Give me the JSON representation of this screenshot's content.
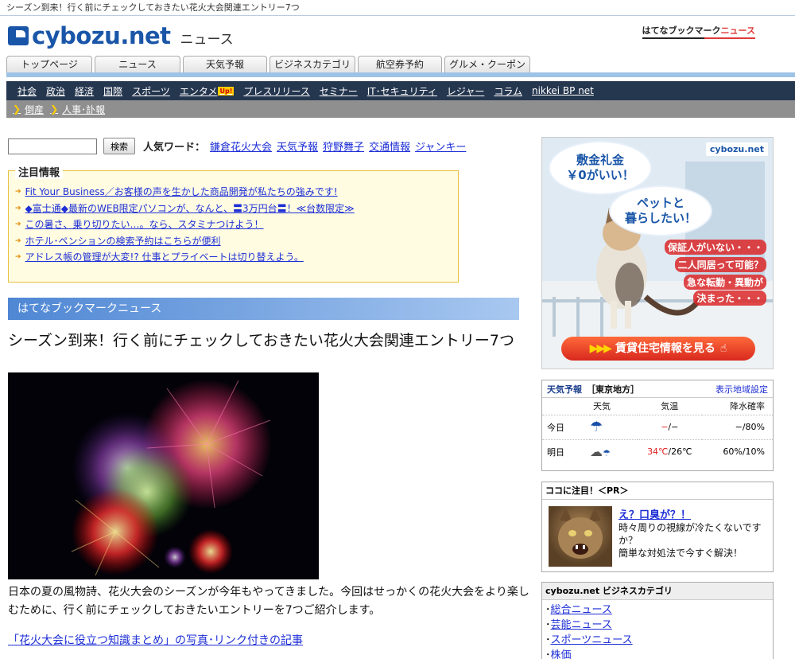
{
  "topline": "シーズン到来！行く前にチェックしておきたい花火大会関連エントリー7つ",
  "header": {
    "logo_main": "cybozu",
    "logo_tld": ".net",
    "logo_sub": "ニュース",
    "badge_dark": "はてなブックマーク",
    "badge_accent": "ニュース"
  },
  "tabs": [
    {
      "label": "トップページ"
    },
    {
      "label": "ニュース"
    },
    {
      "label": "天気予報"
    },
    {
      "label": "ビジネスカテゴリ"
    },
    {
      "label": "航空券予約"
    },
    {
      "label": "グルメ・クーポン"
    }
  ],
  "nav": [
    {
      "label": "社会"
    },
    {
      "label": "政治"
    },
    {
      "label": "経済"
    },
    {
      "label": "国際"
    },
    {
      "label": "スポーツ"
    },
    {
      "label": "エンタメ",
      "badge": "Up!"
    },
    {
      "label": "プレスリリース"
    },
    {
      "label": "セミナー"
    },
    {
      "label": "IT･セキュリティ"
    },
    {
      "label": "レジャー"
    },
    {
      "label": "コラム"
    },
    {
      "label": "nikkei BP net"
    }
  ],
  "subnav": [
    {
      "label": "倒産"
    },
    {
      "label": "人事･訃報"
    }
  ],
  "search": {
    "value": "",
    "button": "検索",
    "popular_label": "人気ワード：",
    "words": [
      "鎌倉花火大会",
      "天気予報",
      "狩野舞子",
      "交通情報",
      "ジャンキー"
    ]
  },
  "notice": {
    "title": "注目情報",
    "items": [
      "Fit Your Business／お客様の声を生かした商品開発が私たちの強みです!",
      "◆富士通◆最新のWEB限定パソコンが、なんと、〓3万円台〓！≪台数限定≫",
      "この暑さ、乗り切りたい…。なら、スタミナつけよう！",
      "ホテル･ペンションの検索予約はこちらが便利",
      "アドレス帳の管理が大変!? 仕事とプライベートは切り替えよう。"
    ]
  },
  "hatena_bar": "はてなブックマークニュース",
  "article": {
    "title": "シーズン到来！行く前にチェックしておきたい花火大会関連エントリー7つ",
    "body": "日本の夏の風物詩、花火大会のシーズンが今年もやってきました。今回はせっかくの花火大会をより楽しむために、行く前にチェックしておきたいエントリーを7つご紹介します。",
    "link": "「花火大会に役立つ知識まとめ」の写真･リンク付きの記事"
  },
  "ad": {
    "logo": "cybozu.net",
    "bubble1": "敷金礼金\n￥0がいい！",
    "bubble2": "ペットと\n暮らしたい！",
    "red_lines": [
      "保証人がいない・・・",
      "二人同居って可能？",
      "急な転勤・異動が",
      "決まった・・・"
    ],
    "cta": "賃貸住宅情報を見る",
    "cta_arrows": "▶▶▶"
  },
  "weather": {
    "title": "天気予報",
    "region": "［東京地方］",
    "settings_link": "表示地域設定",
    "headers": [
      "",
      "天気",
      "気温",
      "降水確率"
    ],
    "rows": [
      {
        "day": "今日",
        "icon": "umbrella-icon",
        "temp_high": "−",
        "temp_sep": "/",
        "temp_low": "−",
        "rain": "−/80%"
      },
      {
        "day": "明日",
        "icon": "rain-cloud-icon",
        "temp_high": "34℃",
        "temp_sep": "/",
        "temp_low": "26℃",
        "rain": "60%/10%"
      }
    ]
  },
  "pr": {
    "head": "ココに注目！＜PR＞",
    "link": "え？口臭が？！",
    "text": "時々周りの視線が冷たくないですか？\n簡単な対処法で今すぐ解決！"
  },
  "biz": {
    "head": "cybozu.net ビジネスカテゴリ",
    "items": [
      "総合ニュース",
      "芸能ニュース",
      "スポーツニュース",
      "株価"
    ]
  },
  "colors": {
    "brand": "#1a56a8",
    "navbar": "#25364f",
    "link": "#1e2fd6",
    "notice_bg": "#fffce2",
    "hot": "#e02020"
  }
}
